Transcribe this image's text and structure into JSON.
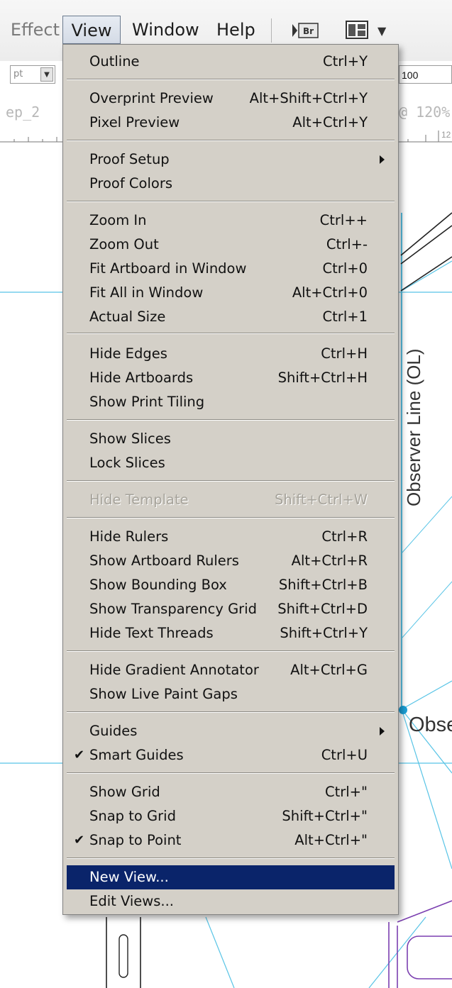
{
  "menubar": {
    "effect": "Effect",
    "view": "View",
    "window": "Window",
    "help": "Help",
    "bridge_icon": "Br",
    "workspace_icon": "workspace-switcher-icon"
  },
  "background": {
    "control_value": "100",
    "zoom_fragment": "@ 120%",
    "tab_fragment": "ep_2",
    "observer_label": "Observer Line (OL)",
    "obs_fragment": "Obse",
    "ruler_number": "12"
  },
  "menu": {
    "title": "View",
    "items": [
      {
        "label": "Outline",
        "shortcut": "Ctrl+Y"
      },
      {
        "label": "Overprint Preview",
        "shortcut": "Alt+Shift+Ctrl+Y"
      },
      {
        "label": "Pixel Preview",
        "shortcut": "Alt+Ctrl+Y"
      },
      {
        "label": "Proof Setup",
        "shortcut": "",
        "submenu": true
      },
      {
        "label": "Proof Colors",
        "shortcut": ""
      },
      {
        "label": "Zoom In",
        "shortcut": "Ctrl++"
      },
      {
        "label": "Zoom Out",
        "shortcut": "Ctrl+-"
      },
      {
        "label": "Fit Artboard in Window",
        "shortcut": "Ctrl+0"
      },
      {
        "label": "Fit All in Window",
        "shortcut": "Alt+Ctrl+0"
      },
      {
        "label": "Actual Size",
        "shortcut": "Ctrl+1"
      },
      {
        "label": "Hide Edges",
        "shortcut": "Ctrl+H"
      },
      {
        "label": "Hide Artboards",
        "shortcut": "Shift+Ctrl+H"
      },
      {
        "label": "Show Print Tiling",
        "shortcut": ""
      },
      {
        "label": "Show Slices",
        "shortcut": ""
      },
      {
        "label": "Lock Slices",
        "shortcut": ""
      },
      {
        "label": "Hide Template",
        "shortcut": "Shift+Ctrl+W",
        "disabled": true
      },
      {
        "label": "Hide Rulers",
        "shortcut": "Ctrl+R"
      },
      {
        "label": "Show Artboard Rulers",
        "shortcut": "Alt+Ctrl+R"
      },
      {
        "label": "Show Bounding Box",
        "shortcut": "Shift+Ctrl+B"
      },
      {
        "label": "Show Transparency Grid",
        "shortcut": "Shift+Ctrl+D"
      },
      {
        "label": "Hide Text Threads",
        "shortcut": "Shift+Ctrl+Y"
      },
      {
        "label": "Hide Gradient Annotator",
        "shortcut": "Alt+Ctrl+G"
      },
      {
        "label": "Show Live Paint Gaps",
        "shortcut": ""
      },
      {
        "label": "Guides",
        "shortcut": "",
        "submenu": true
      },
      {
        "label": "Smart Guides",
        "shortcut": "Ctrl+U",
        "checked": true
      },
      {
        "label": "Show Grid",
        "shortcut": "Ctrl+\""
      },
      {
        "label": "Snap to Grid",
        "shortcut": "Shift+Ctrl+\""
      },
      {
        "label": "Snap to Point",
        "shortcut": "Alt+Ctrl+\"",
        "checked": true
      },
      {
        "label": "New View...",
        "shortcut": "",
        "active": true
      },
      {
        "label": "Edit Views...",
        "shortcut": ""
      }
    ]
  },
  "colors": {
    "menu_bg": "#d4d0c8",
    "highlight": "#0a246a",
    "guide": "#35b8e0",
    "accent_purple": "#7b3fb0"
  }
}
